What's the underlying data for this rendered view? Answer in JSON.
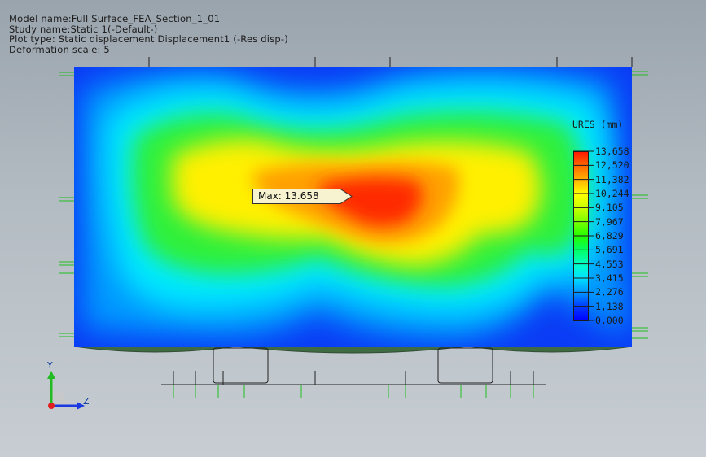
{
  "header": {
    "model_name": "Model name:Full Surface_FEA_Section_1_01",
    "study_name": "Study name:Static 1(-Default-)",
    "plot_type": "Plot type: Static displacement Displacement1 (-Res disp-)",
    "deformation_scale": "Deformation scale: 5"
  },
  "legend": {
    "title": "URES (mm)",
    "labels": [
      "13,658",
      "12,520",
      "11,382",
      "10,244",
      "9,105",
      "7,967",
      "6,829",
      "5,691",
      "4,553",
      "3,415",
      "2,276",
      "1,138",
      "0,000"
    ],
    "colors": [
      "#ff1a00",
      "#ff6a00",
      "#ffb400",
      "#ffff00",
      "#c8ff00",
      "#78ff00",
      "#22ff00",
      "#00ff64",
      "#00ffc8",
      "#00e1ff",
      "#0096ff",
      "#003cff",
      "#0000ff"
    ]
  },
  "max_callout": {
    "text": "Max: 13.658",
    "value": 13.658
  },
  "axes": {
    "y_label": "Y",
    "z_label": "Z"
  },
  "icons": {
    "triad": "coordinate-triad-icon"
  }
}
